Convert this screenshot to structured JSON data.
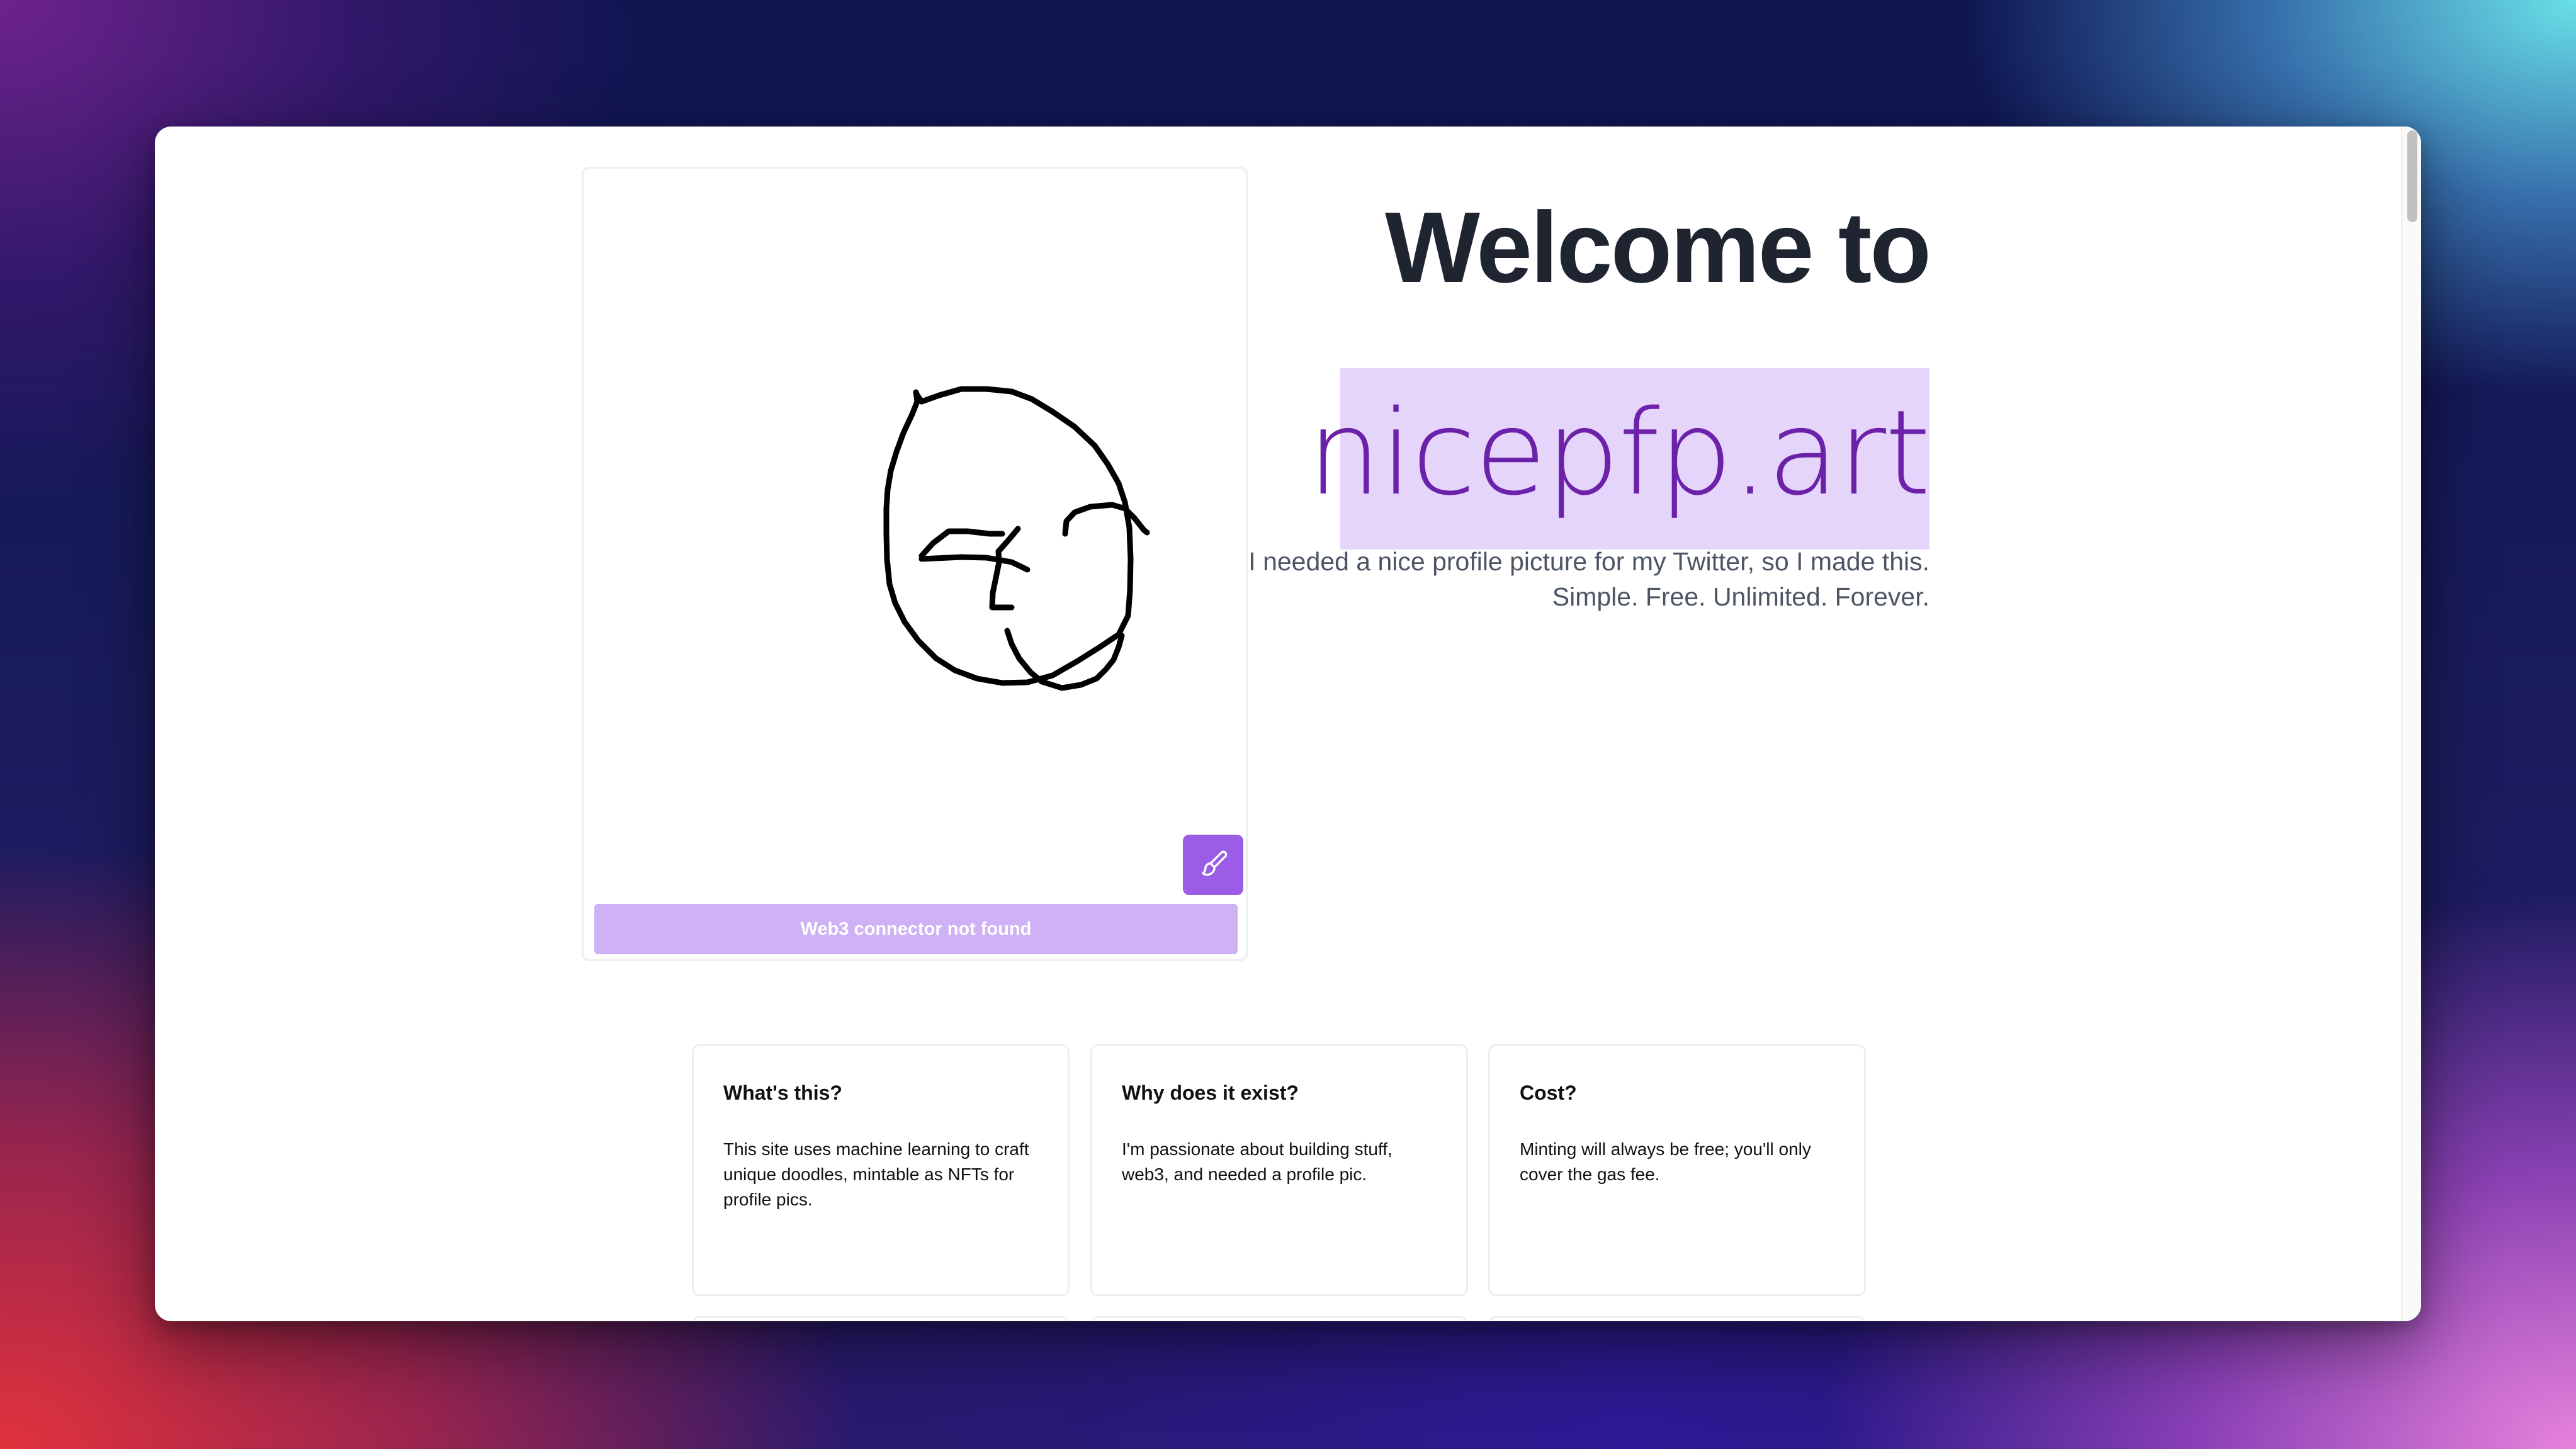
{
  "hero": {
    "title_line1": "Welcome to",
    "brand": "nicepfp.art",
    "subtitle": "I needed a nice profile picture for my Twitter, so I made this. Simple. Free. Unlimited. Forever."
  },
  "canvas": {
    "connect_button_label": "Web3 connector not found",
    "brush_icon": "paintbrush-icon"
  },
  "faq": [
    {
      "title": "What's this?",
      "body": "This site uses machine learning to craft unique doodles, mintable as NFTs for profile pics."
    },
    {
      "title": "Why does it exist?",
      "body": "I'm passionate about building stuff, web3, and needed a profile pic."
    },
    {
      "title": "Cost?",
      "body": "Minting will always be free; you'll only cover the gas fee."
    }
  ],
  "colors": {
    "accent": "#9b5de5",
    "accent_disabled": "#cfb2f6",
    "brand_highlight": "#e6d5fb",
    "brand_text": "#6b21a8",
    "title_text": "#1f2530"
  }
}
